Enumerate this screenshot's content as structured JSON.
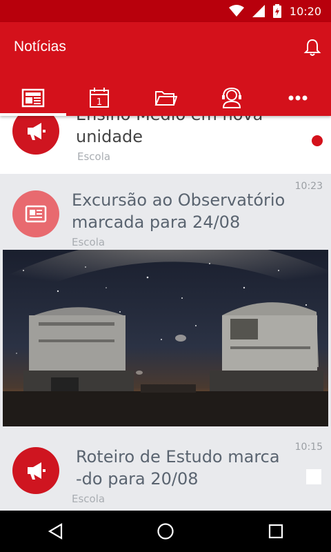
{
  "status": {
    "time": "10:20"
  },
  "header": {
    "title": "Notícias"
  },
  "tabs": [
    {
      "name": "news-tab",
      "icon": "newspaper-icon"
    },
    {
      "name": "calendar-tab",
      "icon": "calendar-icon",
      "day": "1"
    },
    {
      "name": "folder-tab",
      "icon": "folder-icon"
    },
    {
      "name": "contact-tab",
      "icon": "support-agent-icon"
    },
    {
      "name": "more-tab",
      "icon": "more-horizontal-icon"
    }
  ],
  "feed": [
    {
      "title_line1": "Ensino Médio em nova",
      "title_line2": "unidade",
      "source": "Escola",
      "unread": true
    },
    {
      "title_line1": "Excursão ao Observatório",
      "title_line2": "marcada para 24/08",
      "source": "Escola",
      "time": "10:23"
    },
    {
      "title_line1": "Roteiro de Estudo marca",
      "title_line2": "-do para 20/08",
      "source": "Escola",
      "time": "10:15"
    }
  ],
  "colors": {
    "primary": "#d4111b",
    "status": "#b8000c",
    "avatar_pink": "#e86a6f"
  }
}
